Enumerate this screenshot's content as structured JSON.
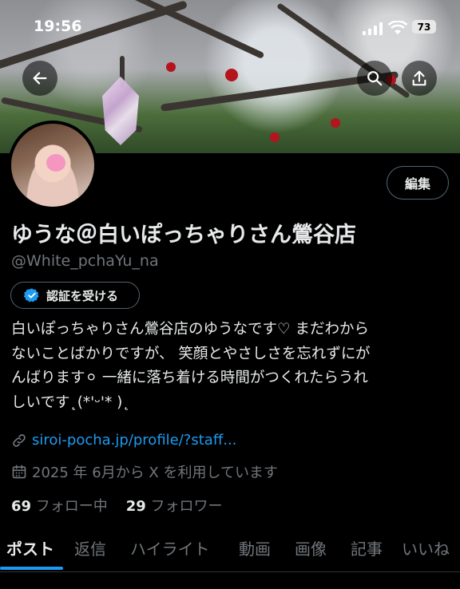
{
  "status_bar": {
    "time": "19:56",
    "battery": "73"
  },
  "profile": {
    "display_name": "ゆうな＠白いぽっちゃりさん鶯谷店",
    "handle": "@White_pchaYu_na",
    "edit_label": "編集",
    "verify_label": "認証を受ける",
    "bio_lines": [
      "白いぽっちゃりさん鶯谷店のゆうなです♡ まだわから",
      "ないことばかりですが、 笑顔とやさしさを忘れずにが",
      "んばります⚪︎ 一緒に落ち着ける時間がつくれたらうれ",
      "しいです˛(*'ᵕ'* )˛"
    ],
    "link": "siroi-pocha.jp/profile/?staff...",
    "joined": "2025 年 6月から X を利用しています",
    "following_count": "69",
    "following_label": "フォロー中",
    "followers_count": "29",
    "followers_label": "フォロワー"
  },
  "tabs": [
    "ポスト",
    "返信",
    "ハイライト",
    "動画",
    "画像",
    "記事",
    "いいね"
  ],
  "icons": [
    "back-arrow-icon",
    "search-icon",
    "share-icon",
    "verified-badge-icon",
    "link-icon",
    "calendar-icon"
  ],
  "colors": {
    "accent": "#1d9bf0",
    "muted": "#71767b",
    "text": "#e7e9ea",
    "background": "#000000"
  }
}
